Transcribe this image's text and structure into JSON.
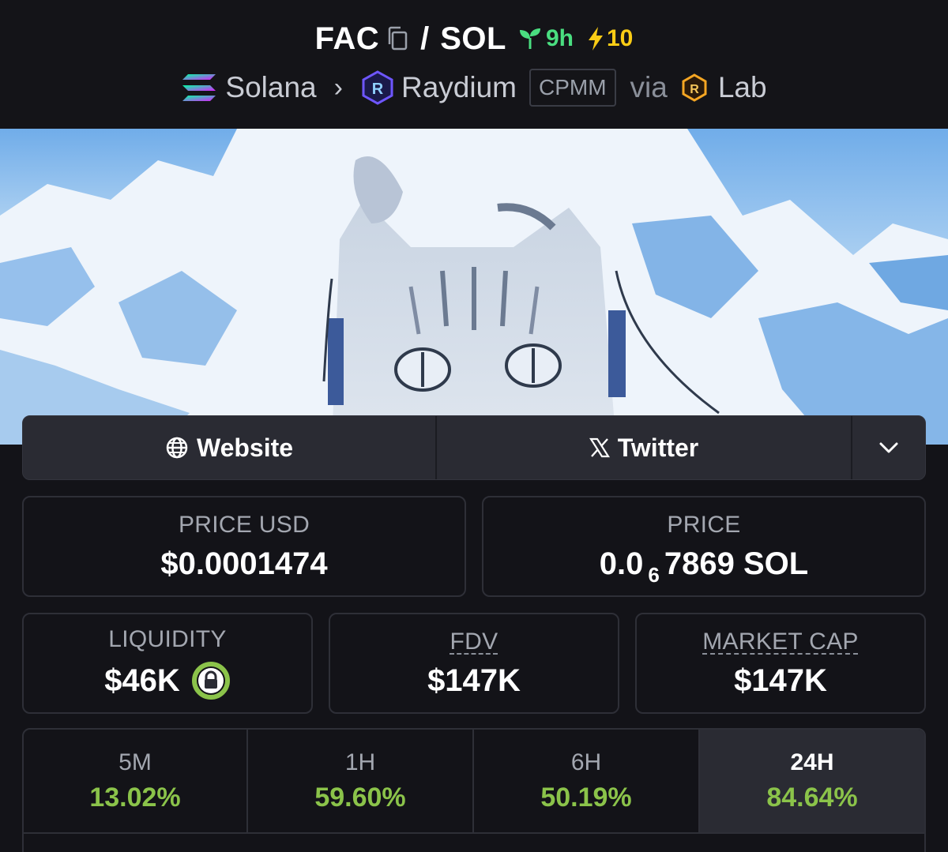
{
  "header": {
    "base_token": "FAC",
    "separator": "/",
    "quote_token": "SOL",
    "age": "9h",
    "boosts": "10",
    "chain": "Solana",
    "dex": "Raydium",
    "pool_type": "CPMM",
    "via_label": "via",
    "launchpad": "Lab"
  },
  "links": {
    "website_label": "Website",
    "twitter_label": "Twitter"
  },
  "stats": {
    "price_usd": {
      "label": "PRICE USD",
      "value": "$0.0001474"
    },
    "price_native": {
      "label": "PRICE",
      "prefix": "0.0",
      "zeros": "6",
      "suffix": "7869 SOL"
    },
    "liquidity": {
      "label": "LIQUIDITY",
      "value": "$46K"
    },
    "fdv": {
      "label": "FDV",
      "value": "$147K"
    },
    "market_cap": {
      "label": "MARKET CAP",
      "value": "$147K"
    }
  },
  "timeframes": [
    {
      "label": "5M",
      "change": "13.02%"
    },
    {
      "label": "1H",
      "change": "59.60%"
    },
    {
      "label": "6H",
      "change": "50.19%"
    },
    {
      "label": "24H",
      "change": "84.64%"
    }
  ],
  "colors": {
    "background": "#131318",
    "positive": "#8bc34a",
    "age_green": "#4ade80",
    "boost_yellow": "#facc15",
    "card_border": "#2e2f37"
  },
  "icons": {
    "copy": "copy-icon",
    "age": "seedling-icon",
    "boost": "lightning-icon",
    "chain": "solana-icon",
    "dex": "raydium-icon",
    "launchpad": "raydium-lab-icon",
    "website": "globe-icon",
    "twitter": "x-icon",
    "more": "chevron-down-icon",
    "lock": "lock-icon"
  }
}
